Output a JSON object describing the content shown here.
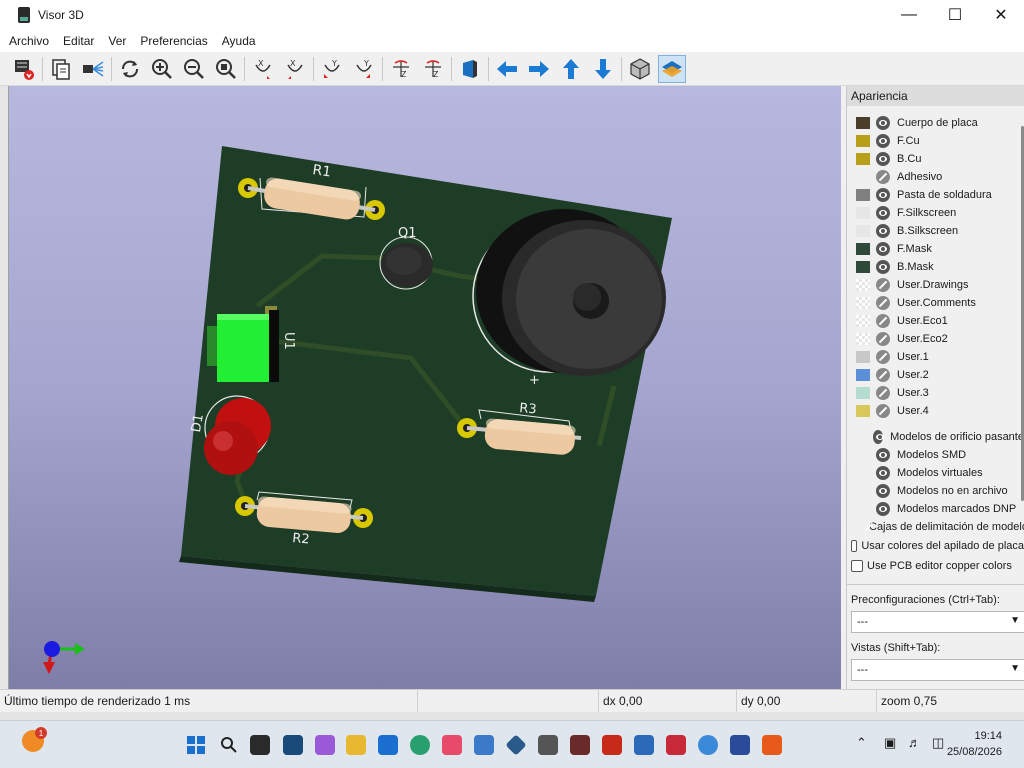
{
  "window": {
    "title": "Visor 3D",
    "minimize": "—",
    "maximize": "☐",
    "close": "✕"
  },
  "menu": [
    "Archivo",
    "Editar",
    "Ver",
    "Preferencias",
    "Ayuda"
  ],
  "toolbar": {
    "icons": [
      "render-export-icon",
      "copy-icon",
      "raytrace-icon",
      "reload-icon",
      "zoom-in-icon",
      "zoom-out-icon",
      "zoom-fit-icon",
      "rotate-x-cw-icon",
      "rotate-x-ccw-icon",
      "rotate-y-cw-icon",
      "rotate-y-ccw-icon",
      "rotate-z-cw-icon",
      "rotate-z-ccw-icon",
      "flip-board-icon",
      "arrow-left-icon",
      "arrow-right-icon",
      "arrow-up-icon",
      "arrow-down-icon",
      "ortho-view-icon",
      "appearance-panel-icon"
    ],
    "active": "appearance-panel-icon"
  },
  "board": {
    "labels": {
      "r1": "R1",
      "q1": "Q1",
      "u1": "U1",
      "d1": "D1",
      "r3": "R3",
      "r2": "R2",
      "plus": "+"
    }
  },
  "panel": {
    "title": "Apariencia",
    "layers": [
      {
        "label": "Cuerpo de placa",
        "color": "#4a3f2a",
        "visible": true
      },
      {
        "label": "F.Cu",
        "color": "#b8a019",
        "visible": true
      },
      {
        "label": "B.Cu",
        "color": "#b8a019",
        "visible": true
      },
      {
        "label": "Adhesivo",
        "color": "",
        "visible": false
      },
      {
        "label": "Pasta de soldadura",
        "color": "#808080",
        "visible": true
      },
      {
        "label": "F.Silkscreen",
        "color": "#e6e6e6",
        "visible": true
      },
      {
        "label": "B.Silkscreen",
        "color": "#e6e6e6",
        "visible": true
      },
      {
        "label": "F.Mask",
        "color": "#2f4a3a",
        "visible": true
      },
      {
        "label": "B.Mask",
        "color": "#2f4a3a",
        "visible": true
      },
      {
        "label": "User.Drawings",
        "color": "checker",
        "visible": false
      },
      {
        "label": "User.Comments",
        "color": "checker",
        "visible": false
      },
      {
        "label": "User.Eco1",
        "color": "checker",
        "visible": false
      },
      {
        "label": "User.Eco2",
        "color": "checker",
        "visible": false
      },
      {
        "label": "User.1",
        "color": "#c8c8c8",
        "visible": false
      },
      {
        "label": "User.2",
        "color": "#5b8fd8",
        "visible": false
      },
      {
        "label": "User.3",
        "color": "#b4dcd0",
        "visible": false
      },
      {
        "label": "User.4",
        "color": "#d8c85a",
        "visible": false
      }
    ],
    "models": [
      {
        "label": "Modelos de orificio pasante",
        "visible": true
      },
      {
        "label": "Modelos SMD",
        "visible": true
      },
      {
        "label": "Modelos virtuales",
        "visible": true
      },
      {
        "label": "Modelos no en archivo",
        "visible": true
      },
      {
        "label": "Modelos marcados DNP",
        "visible": true
      },
      {
        "label": "Cajas de delimitación de modelos",
        "visible": false
      }
    ],
    "check_stackup": "Usar colores del apilado de placa",
    "check_copper": "Use PCB editor copper colors",
    "presets_label": "Preconfiguraciones (Ctrl+Tab):",
    "presets_value": "---",
    "views_label": "Vistas (Shift+Tab):",
    "views_value": "---"
  },
  "status": {
    "render_time": "Último tiempo de renderizado 1 ms",
    "dx": "dx 0,00",
    "dy": "dy 0,00",
    "zoom": "zoom 0,75"
  },
  "taskbar": {
    "notification_count": "1",
    "time": "19:14",
    "date": "25/08/2026"
  }
}
